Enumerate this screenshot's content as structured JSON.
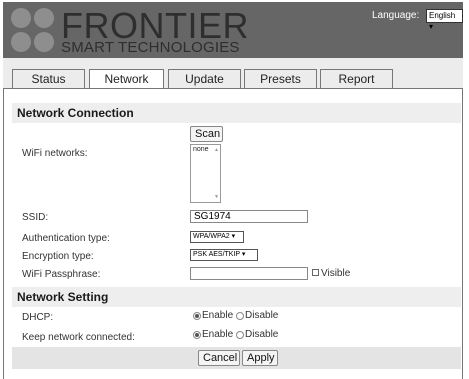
{
  "header": {
    "brand": "FRONTIER",
    "brand_sub": "SMART TECHNOLOGIES",
    "language_label": "Language:",
    "language_value": "English",
    "bg_color": "#666666"
  },
  "tabs": [
    {
      "label": "Status"
    },
    {
      "label": "Network"
    },
    {
      "label": "Update"
    },
    {
      "label": "Presets"
    },
    {
      "label": "Report"
    }
  ],
  "active_tab": "Network",
  "network_connection": {
    "title": "Network Connection",
    "scan_label": "Scan",
    "wifi_label": "WiFi networks:",
    "wifi_list": [
      "none"
    ],
    "ssid_label": "SSID:",
    "ssid_value": "SG1974",
    "auth_label": "Authentication type:",
    "auth_value": "WPA/WPA2",
    "enc_label": "Encryption type:",
    "enc_value": "PSK AES/TKIP",
    "pass_label": "WiFi Passphrase:",
    "pass_value": "",
    "visible_label": "Visible"
  },
  "network_setting": {
    "title": "Network Setting",
    "dhcp_label": "DHCP:",
    "keep_label": "Keep network connected:",
    "enable_label": "Enable",
    "disable_label": "Disable",
    "dhcp_value": "Enable",
    "keep_value": "Enable"
  },
  "footer": {
    "cancel_label": "Cancel",
    "apply_label": "Apply"
  }
}
